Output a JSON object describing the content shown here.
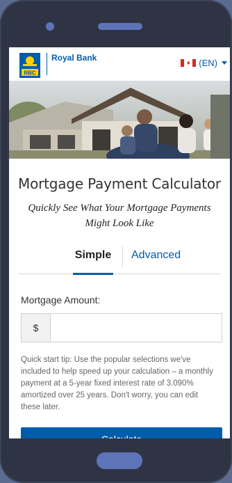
{
  "header": {
    "logo_text": "RBC",
    "brand": "Royal Bank",
    "language": "(EN)"
  },
  "calculator": {
    "title": "Mortgage Payment Calculator",
    "subtitle": "Quickly See What Your Mortgage Payments Might Look Like",
    "tabs": [
      {
        "label": "Simple",
        "active": true
      },
      {
        "label": "Advanced",
        "active": false
      }
    ],
    "amount_label": "Mortgage Amount:",
    "currency_symbol": "$",
    "amount_value": "",
    "tip": "Quick start tip: Use the popular selections we've included to help speed up your calculation – a monthly payment at a 5-year fixed interest rate of 3.090% amortized over 25 years. Don't worry, you can edit these later.",
    "calculate_label": "Calculate"
  },
  "colors": {
    "brand_blue": "#005daa",
    "device_frame": "#2f3445",
    "background": "#5b6a8f"
  }
}
